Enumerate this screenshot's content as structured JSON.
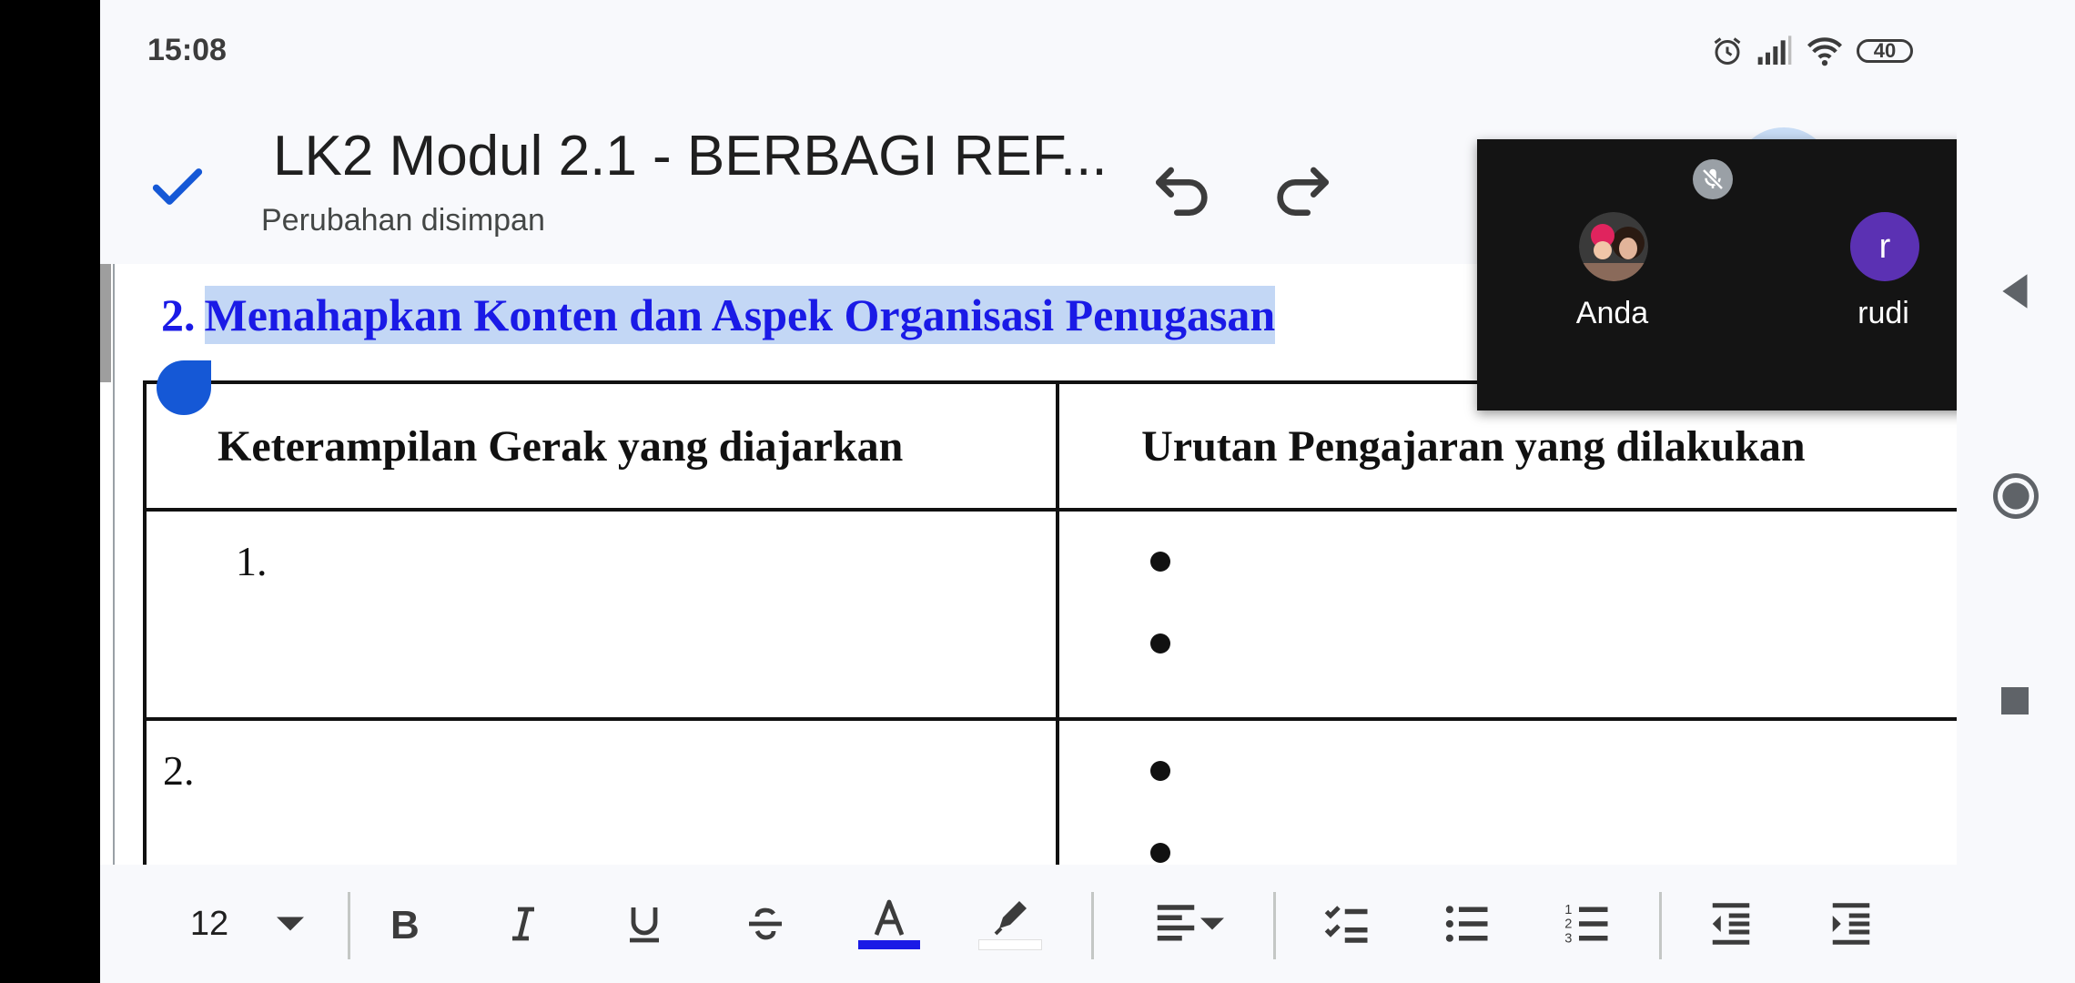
{
  "status_bar": {
    "time": "15:08",
    "battery": "40"
  },
  "header": {
    "title": "LK2 Modul 2.1 - BERBAGI REF...",
    "save_status": "Perubahan disimpan"
  },
  "document": {
    "heading_number": "2.",
    "heading_text": "Menahapkan Konten dan Aspek Organisasi Penugasan",
    "table": {
      "headers": [
        "Keterampilan Gerak yang diajarkan",
        "Urutan Pengajaran yang dilakukan"
      ],
      "rows": [
        {
          "number": "1."
        },
        {
          "number": "2."
        }
      ]
    }
  },
  "call": {
    "participants": [
      {
        "name": "Anda"
      },
      {
        "name": "rudi",
        "initial": "r"
      }
    ]
  },
  "toolbar": {
    "font_size": "12",
    "text_color": "#1a1ae6"
  },
  "colors": {
    "accent": "#1558d6",
    "selection": "#c3d7f5",
    "call_bg": "#141414",
    "avatar_rudi": "#5b31b3"
  }
}
